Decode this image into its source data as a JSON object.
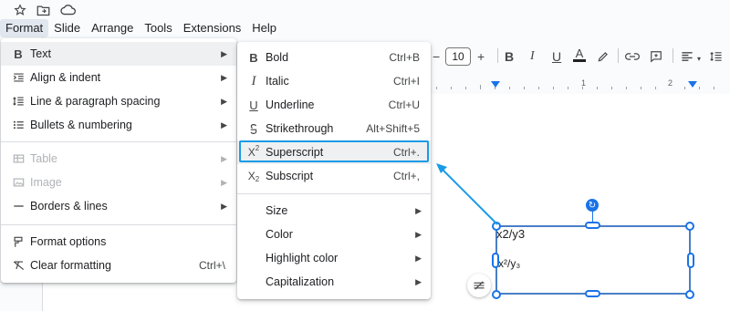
{
  "menubar": {
    "items": [
      "Format",
      "Slide",
      "Arrange",
      "Tools",
      "Extensions",
      "Help"
    ],
    "active": "Format"
  },
  "toolbar": {
    "minus": "−",
    "font_size": "10",
    "plus": "+"
  },
  "ruler": {
    "marks": [
      "1",
      "2"
    ]
  },
  "format_menu": {
    "items": [
      {
        "label": "Text",
        "icon": "bold-icon"
      },
      {
        "label": "Align & indent",
        "icon": "align-indent-icon"
      },
      {
        "label": "Line & paragraph spacing",
        "icon": "line-spacing-icon"
      },
      {
        "label": "Bullets & numbering",
        "icon": "bullets-icon"
      },
      {
        "label": "Table",
        "icon": "table-icon"
      },
      {
        "label": "Image",
        "icon": "image-icon"
      },
      {
        "label": "Borders & lines",
        "icon": "borders-icon"
      },
      {
        "label": "Format options",
        "icon": "format-options-icon"
      },
      {
        "label": "Clear formatting",
        "icon": "clear-formatting-icon",
        "shortcut": "Ctrl+\\"
      }
    ]
  },
  "text_submenu": {
    "items": [
      {
        "label": "Bold",
        "shortcut": "Ctrl+B",
        "icon": "bold-icon"
      },
      {
        "label": "Italic",
        "shortcut": "Ctrl+I",
        "icon": "italic-icon"
      },
      {
        "label": "Underline",
        "shortcut": "Ctrl+U",
        "icon": "underline-icon"
      },
      {
        "label": "Strikethrough",
        "shortcut": "Alt+Shift+5",
        "icon": "strikethrough-icon"
      },
      {
        "label": "Superscript",
        "shortcut": "Ctrl+.",
        "icon": "superscript-icon"
      },
      {
        "label": "Subscript",
        "shortcut": "Ctrl+,",
        "icon": "subscript-icon"
      },
      {
        "label": "Size"
      },
      {
        "label": "Color"
      },
      {
        "label": "Highlight color"
      },
      {
        "label": "Capitalization"
      }
    ]
  },
  "textbox": {
    "line1": "x2/y3",
    "line2": "x²/y₃"
  },
  "colors": {
    "accent": "#1a73e8",
    "highlight_box": "#1a9be6",
    "menu_hover": "#eef0f2"
  }
}
